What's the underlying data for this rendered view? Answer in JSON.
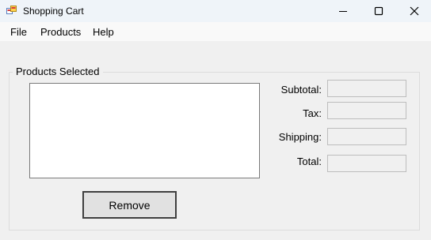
{
  "window": {
    "title": "Shopping Cart",
    "minimize_icon": "minimize-icon",
    "maximize_icon": "maximize-icon",
    "close_icon": "close-icon"
  },
  "menu": {
    "items": [
      {
        "label": "File"
      },
      {
        "label": "Products"
      },
      {
        "label": "Help"
      }
    ]
  },
  "group": {
    "title": "Products Selected",
    "remove_label": "Remove",
    "selected_items": []
  },
  "summary": {
    "subtotal_label": "Subtotal:",
    "subtotal_value": "",
    "tax_label": "Tax:",
    "tax_value": "",
    "shipping_label": "Shipping:",
    "shipping_value": "",
    "total_label": "Total:",
    "total_value": ""
  }
}
